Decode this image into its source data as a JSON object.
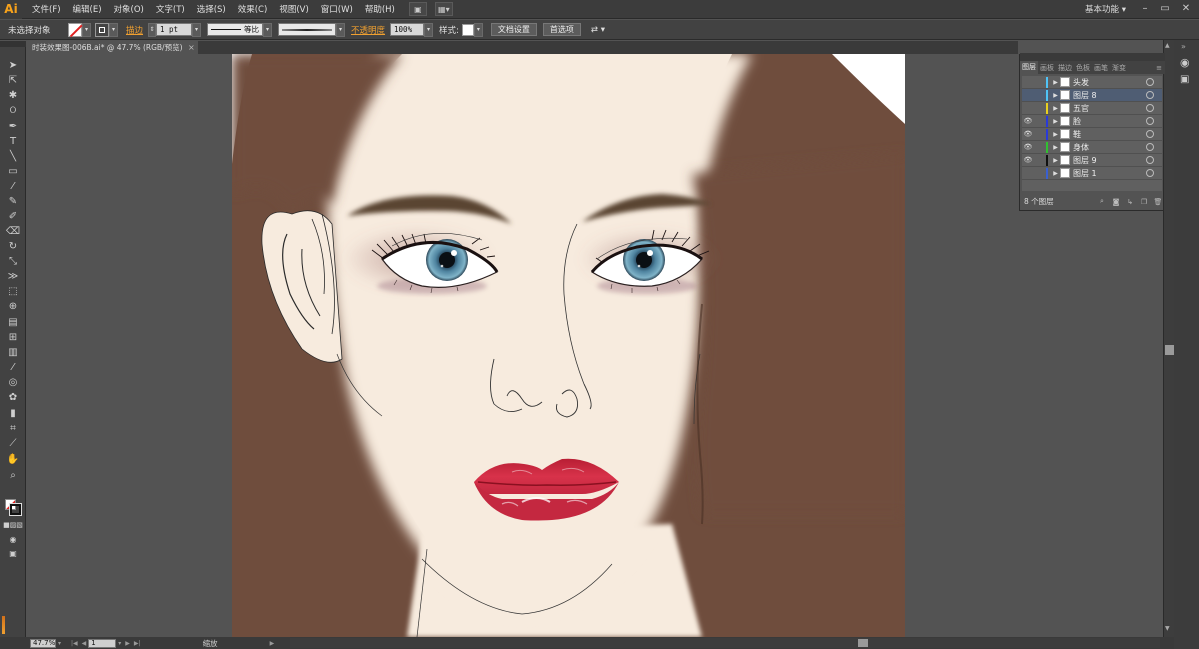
{
  "app": {
    "logo": "Ai",
    "menus": [
      "文件(F)",
      "编辑(E)",
      "对象(O)",
      "文字(T)",
      "选择(S)",
      "效果(C)",
      "视图(V)",
      "窗口(W)",
      "帮助(H)"
    ],
    "workspace": "基本功能"
  },
  "control_bar": {
    "selection_status": "未选择对象",
    "stroke_label": "描边",
    "stroke_weight": "1 pt",
    "stroke_profile": "等比",
    "opacity_label": "不透明度",
    "opacity_value": "100%",
    "style_label": "样式:",
    "doc_setup_button": "文档设置",
    "preferences_button": "首选项"
  },
  "document": {
    "tab_title": "时装效果图-006B.ai* @ 47.7% (RGB/预览)",
    "close_symbol": "×"
  },
  "status_bar": {
    "zoom": "47.7%",
    "artboard_number": "1",
    "tool_label": "缩放"
  },
  "layers_panel": {
    "tabs": [
      "图层",
      "画板",
      "描边",
      "色板",
      "画笔",
      "渐变"
    ],
    "active_tab": "图层",
    "layers": [
      {
        "name": "头发",
        "visible": false,
        "color": "#4fc3f7",
        "selected": false
      },
      {
        "name": "图层 8",
        "visible": false,
        "color": "#4fc3f7",
        "selected": true
      },
      {
        "name": "五官",
        "visible": false,
        "color": "#e8d020",
        "selected": false
      },
      {
        "name": "脸",
        "visible": true,
        "color": "#2a3ad8",
        "selected": false
      },
      {
        "name": "鞋",
        "visible": true,
        "color": "#2a3ad8",
        "selected": false
      },
      {
        "name": "身体",
        "visible": true,
        "color": "#30c030",
        "selected": false
      },
      {
        "name": "图层 9",
        "visible": true,
        "color": "#111111",
        "selected": false
      },
      {
        "name": "图层 1",
        "visible": false,
        "color": "#3a60d0",
        "selected": false
      }
    ],
    "layer_count": "8 个图层"
  },
  "colors": {
    "hair": "#6f4d3d",
    "skin": "#f7ebde",
    "lips": "#c8283e",
    "iris": "#4a7690",
    "brow": "#5a4530"
  }
}
